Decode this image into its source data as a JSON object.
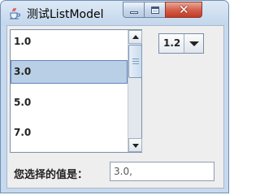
{
  "window": {
    "title": "测试ListModel",
    "close_glyph": "✕",
    "icon": "java-cup-icon"
  },
  "list": {
    "items": [
      "1.0",
      "3.0",
      "5.0",
      "7.0"
    ],
    "selected_index": 1
  },
  "combo": {
    "selected_value": "1.2"
  },
  "value_row": {
    "label": "您选择的值是：",
    "field_value": "3.0,"
  },
  "colors": {
    "selection_bg": "#b8cfe5",
    "close_button": "#c43a22"
  }
}
